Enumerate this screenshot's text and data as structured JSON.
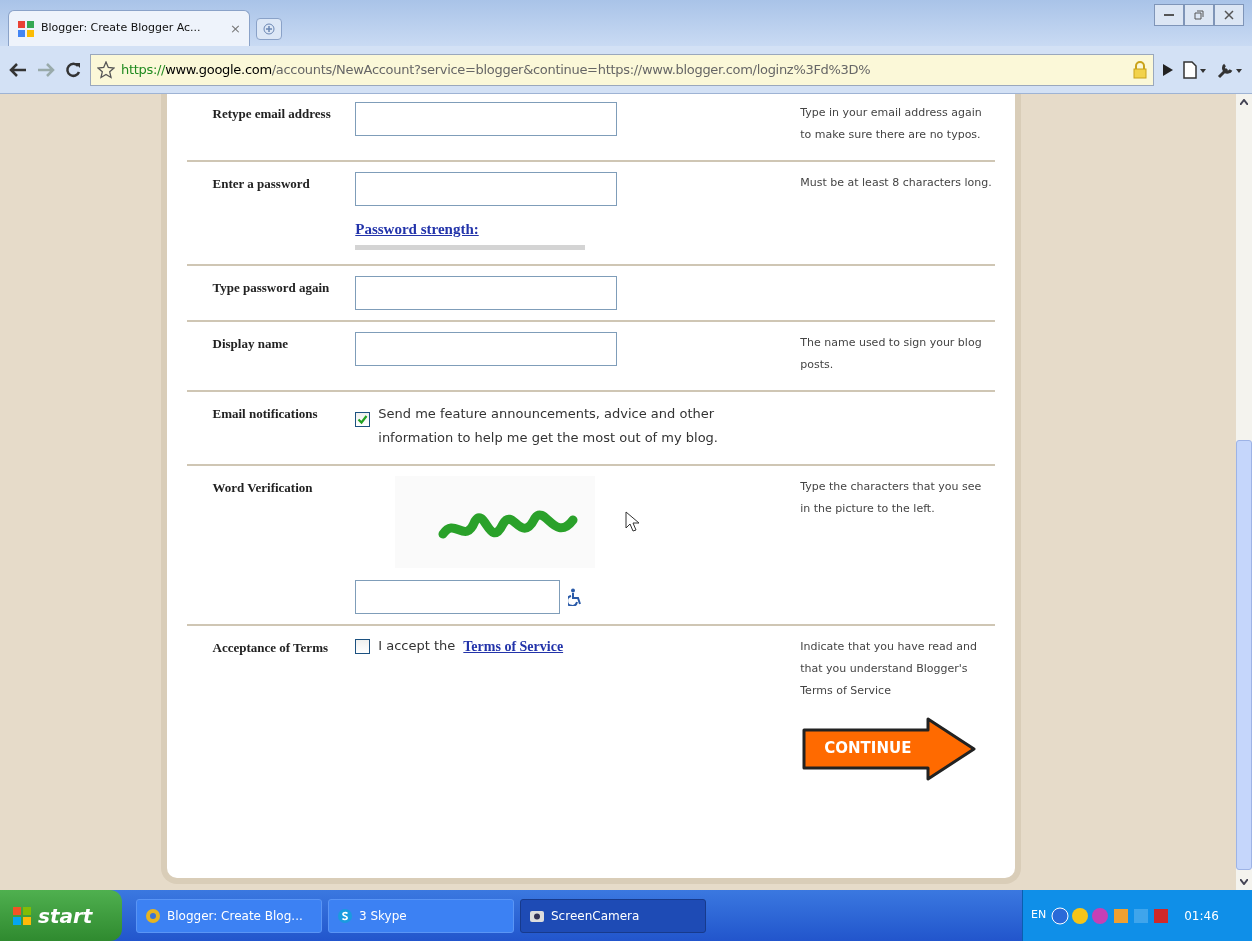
{
  "browser": {
    "tab": {
      "title": "Blogger: Create Blogger Ac...",
      "close": "×"
    },
    "address": {
      "scheme": "https://",
      "host": "www.google.com",
      "path": "/accounts/NewAccount?service=blogger&continue=https://www.blogger.com/loginz%3Fd%3D%"
    }
  },
  "form": {
    "rows": [
      {
        "kind": "field",
        "label": "Retype email address",
        "help": "Type in your email address again to make sure there are no typos."
      },
      {
        "kind": "password",
        "label": "Enter a password",
        "link": "Password strength:",
        "help": "Must be at least 8 characters long."
      },
      {
        "kind": "field",
        "label": "Type password again"
      },
      {
        "kind": "field",
        "label": "Display name",
        "help": "The name used to sign your blog posts."
      },
      {
        "kind": "checkbox",
        "label": "Email notifications",
        "checked": true,
        "text": "Send me feature announcements, advice and other information to help me get the most out of my blog."
      },
      {
        "kind": "captcha",
        "label": "Word Verification",
        "help": "Type the characters that you see in the picture to the left."
      },
      {
        "kind": "terms",
        "label": "Acceptance of Terms",
        "checked": false,
        "text": "I accept the",
        "link": "Terms of Service",
        "help": "Indicate that you have read and that you understand Blogger's Terms of Service"
      }
    ],
    "continue": "CONTINUE"
  },
  "taskbar": {
    "start": "start",
    "items": [
      {
        "kind": "browser",
        "label": "Blogger: Create Blog...",
        "selected": false
      },
      {
        "kind": "skype",
        "label": "3 Skype",
        "selected": false
      },
      {
        "kind": "camera",
        "label": "ScreenCamera",
        "selected": true
      }
    ],
    "language": "EN",
    "time": "01:46"
  }
}
